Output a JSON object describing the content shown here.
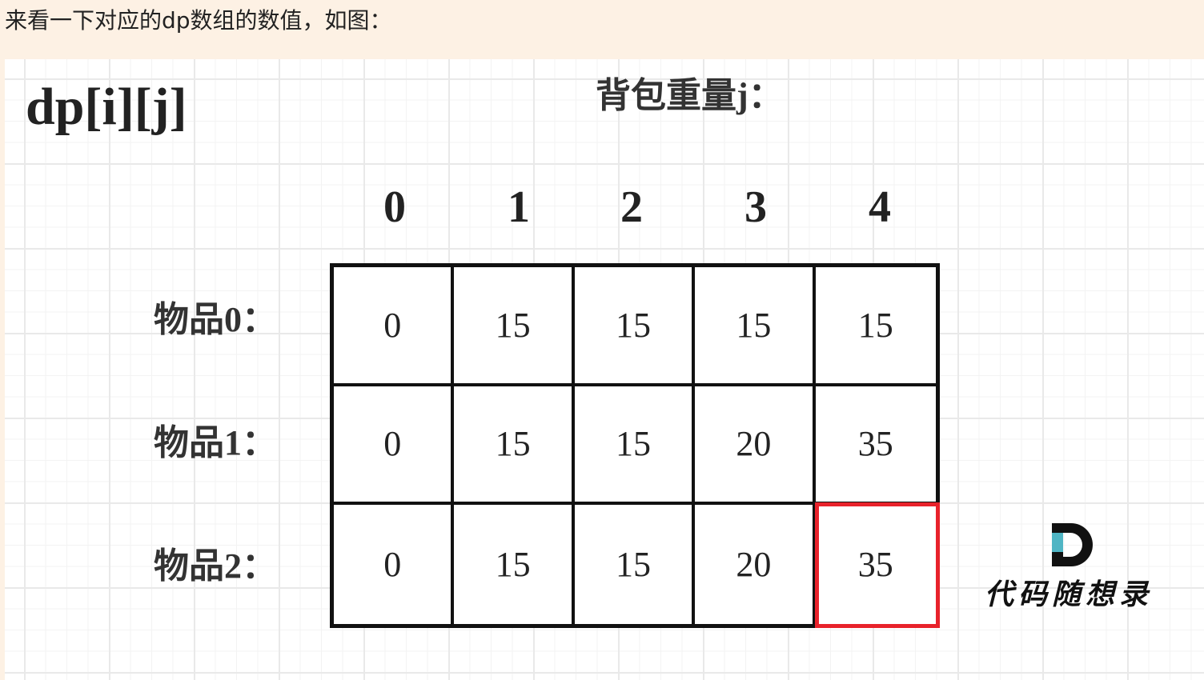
{
  "intro_text": "来看一下对应的dp数组的数值，如图：",
  "figure": {
    "title": "dp[i][j]",
    "axis_title": "背包重量j：",
    "columns": [
      "0",
      "1",
      "2",
      "3",
      "4"
    ],
    "rows": [
      {
        "label": "物品0：",
        "values": [
          "0",
          "15",
          "15",
          "15",
          "15"
        ]
      },
      {
        "label": "物品1：",
        "values": [
          "0",
          "15",
          "15",
          "20",
          "35"
        ]
      },
      {
        "label": "物品2：",
        "values": [
          "0",
          "15",
          "15",
          "20",
          "35"
        ]
      }
    ],
    "highlight": {
      "row": 2,
      "col": 4,
      "color": "#e8222b"
    },
    "logo_text": "代码随想录",
    "logo_colors": {
      "d_outer": "#111111",
      "d_accent": "#4fb5c4"
    }
  }
}
